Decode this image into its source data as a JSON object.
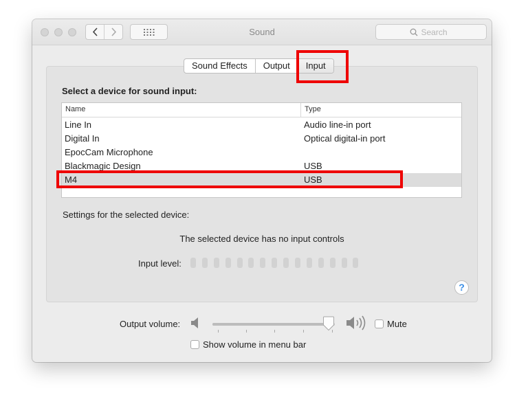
{
  "window": {
    "title": "Sound",
    "search_placeholder": "Search",
    "traffic_lights": [
      "close-icon",
      "minimize-icon",
      "zoom-icon"
    ],
    "nav_icons": [
      "chevron-left-icon",
      "chevron-right-icon",
      "grid-icon"
    ]
  },
  "tabs": [
    {
      "label": "Sound Effects",
      "selected": false
    },
    {
      "label": "Output",
      "selected": false
    },
    {
      "label": "Input",
      "selected": true
    }
  ],
  "input": {
    "heading": "Select a device for sound input:",
    "table": {
      "columns": [
        "Name",
        "Type"
      ],
      "rows": [
        {
          "name": "Line In",
          "type": "Audio line-in port",
          "selected": false
        },
        {
          "name": "Digital In",
          "type": "Optical digital-in port",
          "selected": false
        },
        {
          "name": "EpocCam Microphone",
          "type": "",
          "selected": false
        },
        {
          "name": "Blackmagic Design",
          "type": "USB",
          "selected": false
        },
        {
          "name": "M4",
          "type": "USB",
          "selected": true
        }
      ]
    },
    "settings_label": "Settings for the selected device:",
    "no_controls_message": "The selected device has no input controls",
    "input_level_label": "Input level:",
    "input_level_segments": 15,
    "input_level_active": 0,
    "help_label": "?"
  },
  "output": {
    "volume_label": "Output volume:",
    "volume_value": 0.95,
    "volume_low_icon": "speaker-low-icon",
    "volume_high_icon": "speaker-high-icon",
    "mute_label": "Mute",
    "mute_checked": false,
    "show_in_menu_bar_label": "Show volume in menu bar",
    "show_in_menu_bar_checked": false
  },
  "colors": {
    "highlight": "#ee0000",
    "help_accent": "#3a8ee6",
    "selected_row": "#dcdcdc"
  }
}
